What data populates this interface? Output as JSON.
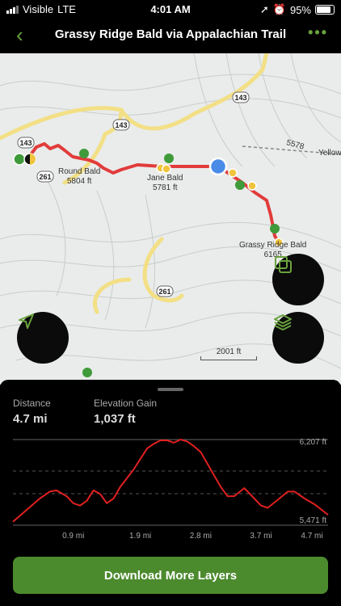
{
  "status": {
    "carrier": "Visible",
    "network": "LTE",
    "time": "4:01 AM",
    "battery": "95%",
    "battery_level": 0.95
  },
  "nav": {
    "title": "Grassy Ridge Bald via Appalachian Trail",
    "back_icon": "chevron-left-icon",
    "more_icon": "more-dots-icon"
  },
  "map": {
    "road_shields": [
      "143",
      "143",
      "143",
      "261",
      "261"
    ],
    "labels": {
      "round_bald_name": "Round Bald",
      "round_bald_elev": "5804 ft",
      "jane_bald_name": "Jane Bald",
      "jane_bald_elev": "5781 ft",
      "grassy_ridge_name": "Grassy Ridge Bald",
      "grassy_ridge_elev": "6165",
      "road_5578": "5578",
      "yellow": "Yellow"
    },
    "scale_label": "2001 ft",
    "colors": {
      "trail": "#e23b3b",
      "road": "#f3df85",
      "accent": "#6aa33d"
    }
  },
  "stats": {
    "distance_label": "Distance",
    "distance_value": "4.7 mi",
    "gain_label": "Elevation Gain",
    "gain_value": "1,037 ft"
  },
  "chart_data": {
    "type": "line",
    "xlabel": "",
    "ylabel": "",
    "x_ticks": [
      "0.9 mi",
      "1.9 mi",
      "2.8 mi",
      "3.7 mi",
      "4.7 mi"
    ],
    "y_ticks": [
      "6,207 ft",
      "5,471 ft"
    ],
    "xlim": [
      0,
      4.7
    ],
    "ylim": [
      5471,
      6207
    ],
    "x": [
      0,
      0.2,
      0.4,
      0.55,
      0.65,
      0.8,
      0.9,
      1.0,
      1.1,
      1.2,
      1.3,
      1.4,
      1.5,
      1.6,
      1.8,
      2.0,
      2.1,
      2.2,
      2.3,
      2.4,
      2.5,
      2.6,
      2.7,
      2.8,
      2.9,
      3.0,
      3.1,
      3.2,
      3.3,
      3.45,
      3.6,
      3.7,
      3.8,
      3.95,
      4.1,
      4.2,
      4.35,
      4.5,
      4.7
    ],
    "y": [
      5500,
      5600,
      5700,
      5760,
      5770,
      5720,
      5660,
      5640,
      5680,
      5770,
      5740,
      5660,
      5700,
      5800,
      5950,
      6130,
      6170,
      6200,
      6200,
      6180,
      6207,
      6190,
      6150,
      6100,
      6000,
      5900,
      5800,
      5720,
      5720,
      5790,
      5700,
      5640,
      5620,
      5690,
      5760,
      5760,
      5700,
      5650,
      5560
    ],
    "line_color": "#e02020"
  },
  "actions": {
    "download_label": "Download More Layers"
  }
}
